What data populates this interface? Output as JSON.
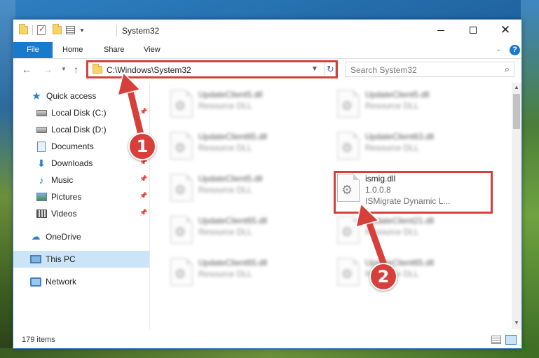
{
  "window": {
    "title": "System32"
  },
  "ribbon": {
    "tabs": [
      "File",
      "Home",
      "Share",
      "View"
    ]
  },
  "navigation": {
    "address": "C:\\Windows\\System32",
    "search_placeholder": "Search System32"
  },
  "sidebar": {
    "items": [
      {
        "label": "Quick access",
        "icon": "star-icon",
        "pinned": false
      },
      {
        "label": "Local Disk (C:)",
        "icon": "disk-icon",
        "pinned": true
      },
      {
        "label": "Local Disk (D:)",
        "icon": "disk-icon",
        "pinned": false
      },
      {
        "label": "Documents",
        "icon": "documents-icon",
        "pinned": true
      },
      {
        "label": "Downloads",
        "icon": "downloads-icon",
        "pinned": true
      },
      {
        "label": "Music",
        "icon": "music-icon",
        "pinned": true
      },
      {
        "label": "Pictures",
        "icon": "pictures-icon",
        "pinned": true
      },
      {
        "label": "Videos",
        "icon": "videos-icon",
        "pinned": true
      },
      {
        "label": "OneDrive",
        "icon": "onedrive-icon",
        "pinned": false
      },
      {
        "label": "This PC",
        "icon": "this-pc-icon",
        "pinned": false,
        "selected": true
      },
      {
        "label": "Network",
        "icon": "network-icon",
        "pinned": false
      }
    ]
  },
  "files": [
    {
      "name": "UpdateClient5.dll",
      "desc": "Resource DLL"
    },
    {
      "name": "UpdateClient5.dll",
      "desc": "Resource DLL"
    },
    {
      "name": "UpdateClient65.dll",
      "desc": "Resource DLL"
    },
    {
      "name": "UpdateClient63.dll",
      "desc": "Resource DLL"
    },
    {
      "name": "UpdateClient5.dll",
      "desc": "Resource DLL"
    },
    {
      "name": "ismig.dll",
      "version": "1.0.0.8",
      "desc": "ISMigrate Dynamic L..."
    },
    {
      "name": "UpdateClient65.dll",
      "desc": "Resource DLL"
    },
    {
      "name": "UpdateClient21.dll",
      "desc": "Resource DLL"
    },
    {
      "name": "UpdateClient65.dll",
      "desc": "Resource DLL"
    },
    {
      "name": "UpdateClient65.dll",
      "desc": "Resource DLL"
    }
  ],
  "status": {
    "item_count": "179 items"
  },
  "annotations": {
    "step1": "1",
    "step2": "2"
  },
  "colors": {
    "accent": "#1979ca",
    "highlight": "#d7403a",
    "selected": "#cce4f7"
  }
}
